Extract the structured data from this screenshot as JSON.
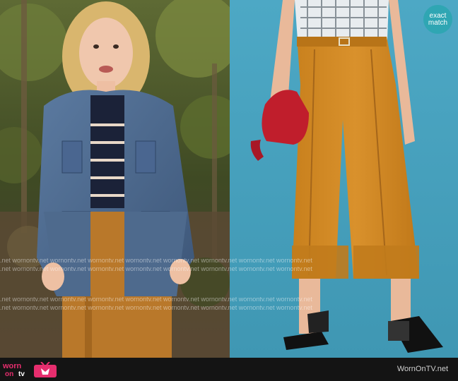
{
  "watermark": {
    "band": ".net wornontv.net wornontv.net wornontv.net wornontv.net wornontv.net wornontv.net wornontv.net wornontv.net"
  },
  "match_badge": {
    "line1": "exact",
    "line2": "match"
  },
  "footer": {
    "logo_worn": "worn",
    "logo_on": "on",
    "logo_tv": "tv",
    "site_name": "WornOnTV.net"
  },
  "colors": {
    "forest": "#4f5a2c",
    "backdrop": "#4aa3bf",
    "badge": "#2fa6b3",
    "logo_pink": "#e62e6e",
    "denim": "#4e6a8d",
    "mustard": "#c9821f",
    "bag_red": "#c01e2c"
  }
}
